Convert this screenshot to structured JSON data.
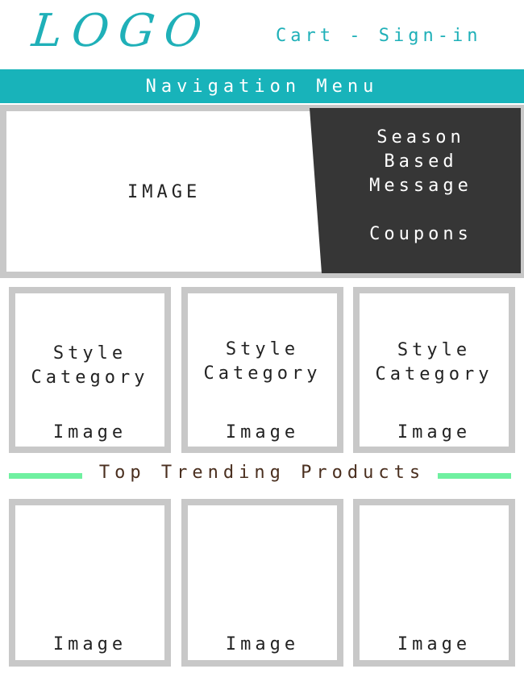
{
  "header": {
    "logo": "LOGO",
    "cart_label": "Cart",
    "separator": " - ",
    "signin_label": "Sign-in"
  },
  "nav": {
    "label": "Navigation Menu"
  },
  "hero": {
    "image_label": "IMAGE",
    "season_message": "Season\nBased\nMessage",
    "coupons_label": "Coupons"
  },
  "categories": [
    {
      "title": "Style\nCategory",
      "image_label": "Image"
    },
    {
      "title": "Style\nCategory",
      "image_label": "Image"
    },
    {
      "title": "Style\nCategory",
      "image_label": "Image"
    }
  ],
  "trending": {
    "title": "Top Trending Products",
    "products": [
      {
        "image_label": "Image"
      },
      {
        "image_label": "Image"
      },
      {
        "image_label": "Image"
      }
    ]
  },
  "colors": {
    "accent": "#18b3ba",
    "dark_panel": "#363636",
    "frame": "#c8c8c8",
    "trend_line": "#6ff0a0",
    "trend_text": "#4a2f1f"
  }
}
